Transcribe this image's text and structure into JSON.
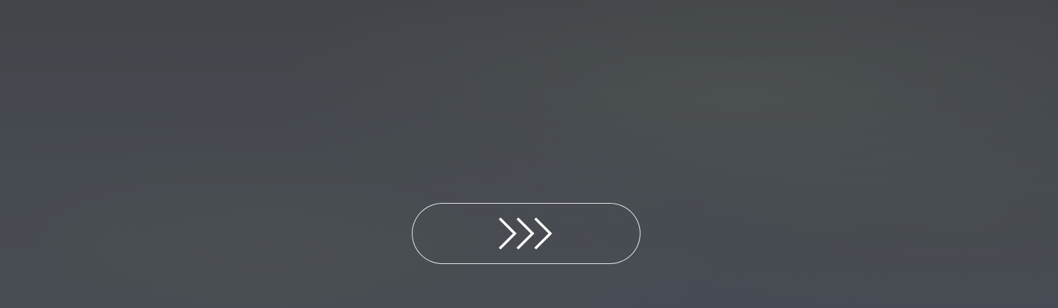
{
  "background": {
    "color": "#444750"
  },
  "controls": {
    "next_button": {
      "icon": "triple-chevron-right-icon",
      "border_color": "#e8e9ec",
      "icon_color": "#ffffff"
    }
  }
}
